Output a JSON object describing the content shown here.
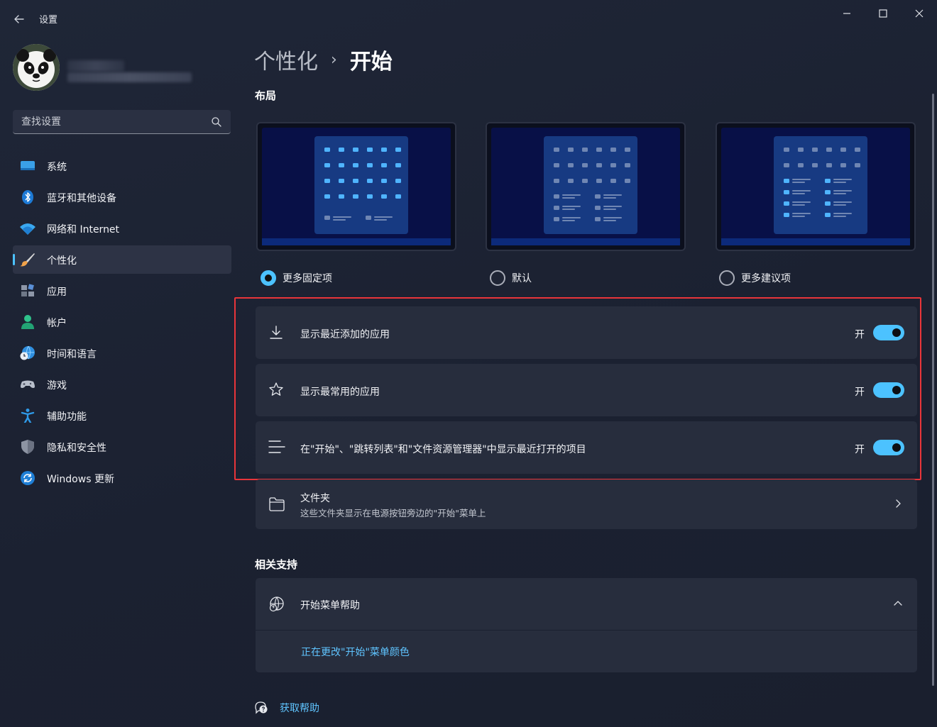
{
  "window": {
    "title": "设置",
    "controls": [
      "minimize",
      "maximize",
      "close"
    ]
  },
  "search": {
    "placeholder": "查找设置"
  },
  "sidebar": {
    "items": [
      {
        "label": "系统",
        "icon": "system-icon",
        "active": false
      },
      {
        "label": "蓝牙和其他设备",
        "icon": "bluetooth-icon",
        "active": false
      },
      {
        "label": "网络和 Internet",
        "icon": "wifi-icon",
        "active": false
      },
      {
        "label": "个性化",
        "icon": "brush-icon",
        "active": true
      },
      {
        "label": "应用",
        "icon": "apps-icon",
        "active": false
      },
      {
        "label": "帐户",
        "icon": "account-icon",
        "active": false
      },
      {
        "label": "时间和语言",
        "icon": "time-language-icon",
        "active": false
      },
      {
        "label": "游戏",
        "icon": "gamepad-icon",
        "active": false
      },
      {
        "label": "辅助功能",
        "icon": "accessibility-icon",
        "active": false
      },
      {
        "label": "隐私和安全性",
        "icon": "shield-icon",
        "active": false
      },
      {
        "label": "Windows 更新",
        "icon": "update-icon",
        "active": false
      }
    ]
  },
  "breadcrumb": {
    "parent": "个性化",
    "separator": "›",
    "current": "开始"
  },
  "layout": {
    "title": "布局",
    "options": [
      {
        "label": "更多固定项",
        "selected": true
      },
      {
        "label": "默认",
        "selected": false
      },
      {
        "label": "更多建议项",
        "selected": false
      }
    ]
  },
  "settings": {
    "rows": [
      {
        "label": "显示最近添加的应用",
        "icon": "download-icon",
        "state": "开",
        "on": true
      },
      {
        "label": "显示最常用的应用",
        "icon": "star-icon",
        "state": "开",
        "on": true
      },
      {
        "label": "在\"开始\"、\"跳转列表\"和\"文件资源管理器\"中显示最近打开的项目",
        "icon": "list-icon",
        "state": "开",
        "on": true
      }
    ],
    "folders": {
      "label": "文件夹",
      "sub": "这些文件夹显示在电源按钮旁边的\"开始\"菜单上",
      "icon": "folder-icon"
    }
  },
  "support": {
    "title": "相关支持",
    "help_title": "开始菜单帮助",
    "help_link": "正在更改\"开始\"菜单颜色"
  },
  "footer": {
    "get_help": "获取帮助"
  },
  "colors": {
    "accent": "#4cc2ff",
    "highlight": "#e8353a",
    "background": "#1c2233",
    "card": "#272d3d"
  }
}
